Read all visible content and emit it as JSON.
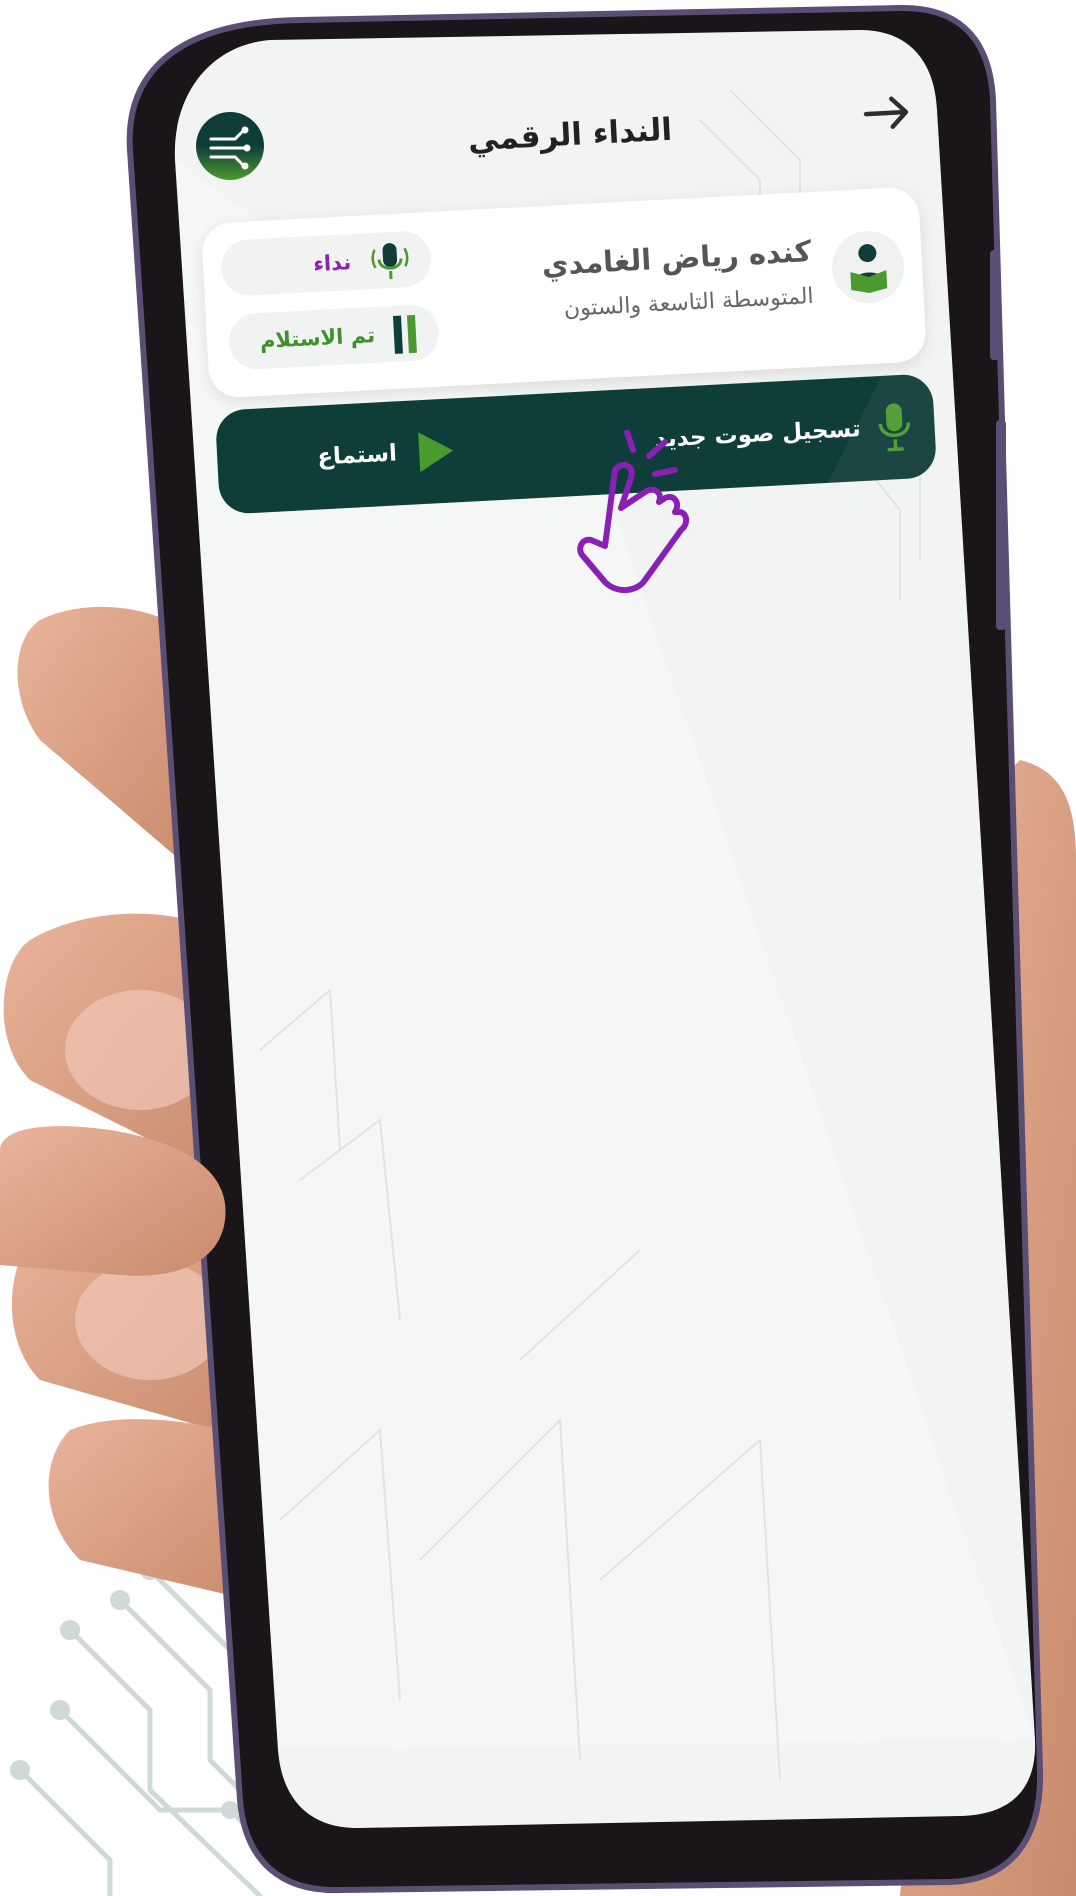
{
  "header": {
    "title": "النداء الرقمي",
    "back_icon": "arrow-right-icon",
    "logo_icon": "circuit-logo-icon"
  },
  "student": {
    "name": "كنده رياض الغامدي",
    "school": "المتوسطة التاسعة والستون",
    "avatar_icon": "student-reading-icon"
  },
  "status": {
    "call_label": "نداء",
    "call_icon": "microphone-broadcast-icon",
    "received_label": "تم الاستلام",
    "received_icon": "status-bars-icon"
  },
  "actions": {
    "record_label": "تسجيل صوت جديد",
    "record_icon": "microphone-icon",
    "listen_label": "استماع",
    "listen_icon": "play-icon"
  },
  "colors": {
    "dark_teal": "#0f3d3a",
    "green": "#4a9a2e",
    "purple": "#8a1fb5"
  }
}
